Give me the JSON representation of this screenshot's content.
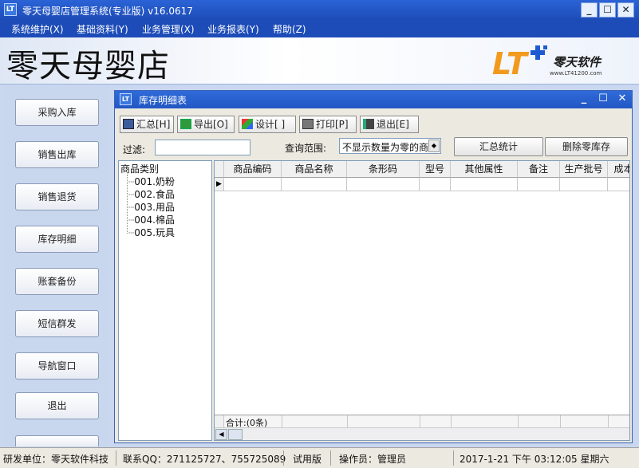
{
  "window": {
    "title": "零天母婴店管理系统(专业版)  v16.0617",
    "app_icon": "LT",
    "min": "_",
    "max": "☐",
    "close": "✕"
  },
  "menu": [
    {
      "label": "系统维护(X)"
    },
    {
      "label": "基础资料(Y)"
    },
    {
      "label": "业务管理(X)"
    },
    {
      "label": "业务报表(Y)"
    },
    {
      "label": "帮助(Z)"
    }
  ],
  "header": {
    "store_name": "零天母婴店",
    "logo_text": "零天软件",
    "logo_url": "www.LT41200.com",
    "logo_letters": "LT"
  },
  "nav": [
    {
      "label": "采购入库"
    },
    {
      "label": "销售出库"
    },
    {
      "label": "销售退货"
    },
    {
      "label": "库存明细"
    },
    {
      "label": "账套备份"
    },
    {
      "label": "短信群发"
    },
    {
      "label": "导航窗口"
    },
    {
      "label": "退出"
    }
  ],
  "child": {
    "title": "库存明细表",
    "toolbar": [
      {
        "label": "汇总[H]",
        "icon": "summary-icon"
      },
      {
        "label": "导出[O]",
        "icon": "export-icon"
      },
      {
        "label": "设计[ ]",
        "icon": "design-icon"
      },
      {
        "label": "打印[P]",
        "icon": "print-icon"
      },
      {
        "label": "退出[E]",
        "icon": "exit-icon"
      }
    ],
    "filter_label": "过滤:",
    "filter_value": "",
    "range_label": "查询范围:",
    "range_value": "不显示数量为零的商",
    "stat_button": "汇总统计",
    "delete_button": "删除零库存",
    "tree": {
      "root": "商品类别",
      "children": [
        "001.奶粉",
        "002.食品",
        "003.用品",
        "004.棉品",
        "005.玩具"
      ]
    },
    "grid": {
      "columns": [
        "商品编码",
        "商品名称",
        "条形码",
        "型号",
        "其他属性",
        "备注",
        "生产批号",
        "成本"
      ],
      "rows": [],
      "row_indicator": "▶",
      "footer": "合计:(0条)"
    }
  },
  "status": {
    "developer": "研发单位：零天软件科技",
    "qq": "联系QQ：271125727、755725089",
    "edition": "试用版",
    "operator": "操作员：管理员",
    "datetime": "2017-1-21  下午  03:12:05  星期六"
  },
  "colors": {
    "titlebar": "#2257c4",
    "menubar": "#1d4cb8",
    "accent_orange": "#f29a1d",
    "logo_blue": "#1e5bd1"
  }
}
